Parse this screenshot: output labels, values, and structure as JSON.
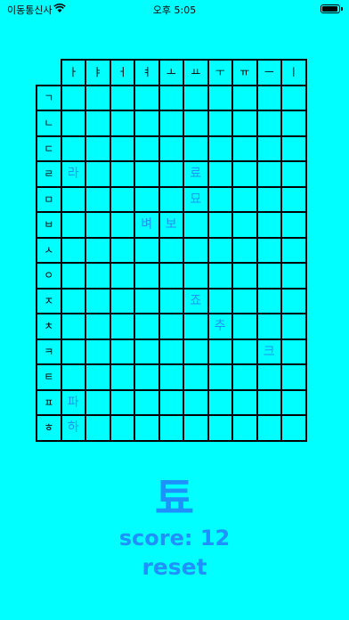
{
  "status_bar": {
    "carrier": "이동통신사",
    "time": "오후 5:05",
    "wifi_icon": "wifi-icon",
    "battery_icon": "battery-icon"
  },
  "grid": {
    "vowels": [
      "ㅏ",
      "ㅑ",
      "ㅓ",
      "ㅕ",
      "ㅗ",
      "ㅛ",
      "ㅜ",
      "ㅠ",
      "ㅡ",
      "ㅣ"
    ],
    "consonants": [
      "ㄱ",
      "ㄴ",
      "ㄷ",
      "ㄹ",
      "ㅁ",
      "ㅂ",
      "ㅅ",
      "ㅇ",
      "ㅈ",
      "ㅊ",
      "ㅋ",
      "ㅌ",
      "ㅍ",
      "ㅎ"
    ],
    "filled": [
      {
        "row": 3,
        "col": 0,
        "char": "라"
      },
      {
        "row": 3,
        "col": 5,
        "char": "료"
      },
      {
        "row": 4,
        "col": 5,
        "char": "묘"
      },
      {
        "row": 5,
        "col": 3,
        "char": "벼"
      },
      {
        "row": 5,
        "col": 4,
        "char": "보"
      },
      {
        "row": 8,
        "col": 5,
        "char": "죠"
      },
      {
        "row": 9,
        "col": 6,
        "char": "추"
      },
      {
        "row": 10,
        "col": 8,
        "char": "크"
      },
      {
        "row": 12,
        "col": 0,
        "char": "파"
      },
      {
        "row": 13,
        "col": 0,
        "char": "하"
      }
    ]
  },
  "current_syllable": "툐",
  "score_text": "score: 12",
  "reset_label": "reset",
  "colors": {
    "background": "#00FFFF",
    "accent": "#1E90FF",
    "grid_line": "#000000"
  }
}
